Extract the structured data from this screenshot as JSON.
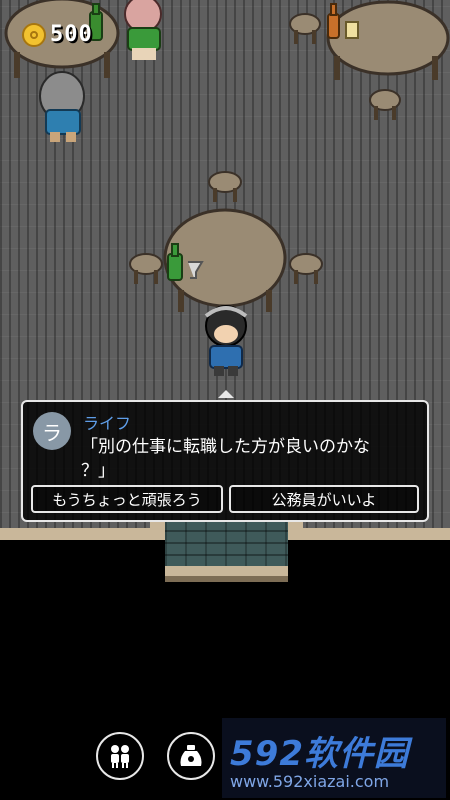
{
  "hud": {
    "coins": "500"
  },
  "dialog": {
    "speaker_initial": "ラ",
    "speaker_name": "ライフ",
    "line1": "「別の仕事に転職した方が良いのかな",
    "line2": "？」",
    "choices": [
      "もうちょっと頑張ろう",
      "公務員がいいよ"
    ]
  },
  "watermark": {
    "brand": "592软件园",
    "url": "www.592xiazai.com"
  },
  "icons": {
    "coin": "coin-icon",
    "party": "party-icon",
    "bag": "item-bag-icon"
  }
}
